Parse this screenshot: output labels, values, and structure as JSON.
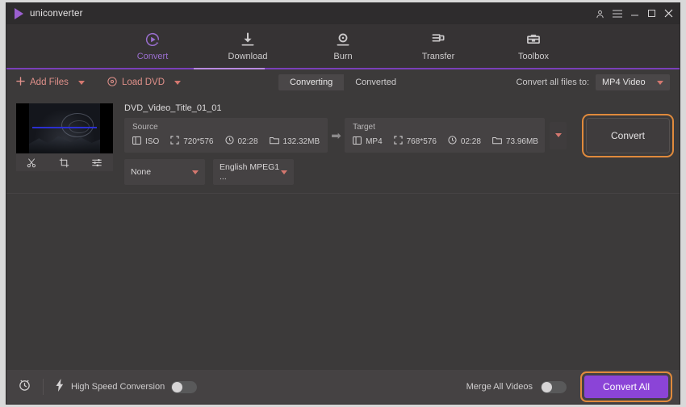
{
  "window": {
    "app_title": "uniconverter",
    "logo_icon": "play-triangle-icon",
    "controls": [
      {
        "name": "account-icon",
        "glyph": "account"
      },
      {
        "name": "menu-icon",
        "glyph": "hamburger"
      },
      {
        "name": "minimize-button",
        "glyph": "_"
      },
      {
        "name": "maximize-button",
        "glyph": "☐"
      },
      {
        "name": "close-button",
        "glyph": "✕"
      }
    ],
    "accent_purple": "#8b44d7",
    "accent_orange": "#e08a3c",
    "accent_salmon": "#e0908a"
  },
  "nav": {
    "tabs": [
      {
        "label": "Convert",
        "icon": "convert-circle-play-icon",
        "active": true
      },
      {
        "label": "Download",
        "icon": "download-arrow-icon",
        "active": false
      },
      {
        "label": "Burn",
        "icon": "burn-disc-icon",
        "active": false
      },
      {
        "label": "Transfer",
        "icon": "transfer-device-icon",
        "active": false
      },
      {
        "label": "Toolbox",
        "icon": "toolbox-icon",
        "active": false
      }
    ]
  },
  "toolbar": {
    "add_files_label": "Add Files",
    "add_files_icon": "plus-icon",
    "load_dvd_label": "Load DVD",
    "load_dvd_icon": "disc-icon",
    "segments": [
      {
        "label": "Converting",
        "active": true
      },
      {
        "label": "Converted",
        "active": false
      }
    ],
    "convert_all_to_label": "Convert all files to:",
    "convert_all_to_value": "MP4 Video"
  },
  "file": {
    "name": "DVD_Video_Title_01_01",
    "thumb_actions": [
      {
        "name": "trim-icon",
        "label": "Trim"
      },
      {
        "name": "crop-icon",
        "label": "Crop"
      },
      {
        "name": "effect-icon",
        "label": "Effect"
      }
    ],
    "source": {
      "title": "Source",
      "format": "ISO",
      "resolution": "720*576",
      "duration": "02:28",
      "size": "132.32MB"
    },
    "target": {
      "title": "Target",
      "format": "MP4",
      "resolution": "768*576",
      "duration": "02:28",
      "size": "73.96MB"
    },
    "subtitle_value": "None",
    "audio_value": "English MPEG1 ...",
    "convert_button": "Convert"
  },
  "bottom": {
    "timer_icon": "alarm-clock-icon",
    "speed_icon": "lightning-bolt-icon",
    "high_speed_label": "High Speed Conversion",
    "high_speed_on": false,
    "merge_label": "Merge All Videos",
    "merge_on": false,
    "convert_all_button": "Convert All"
  }
}
